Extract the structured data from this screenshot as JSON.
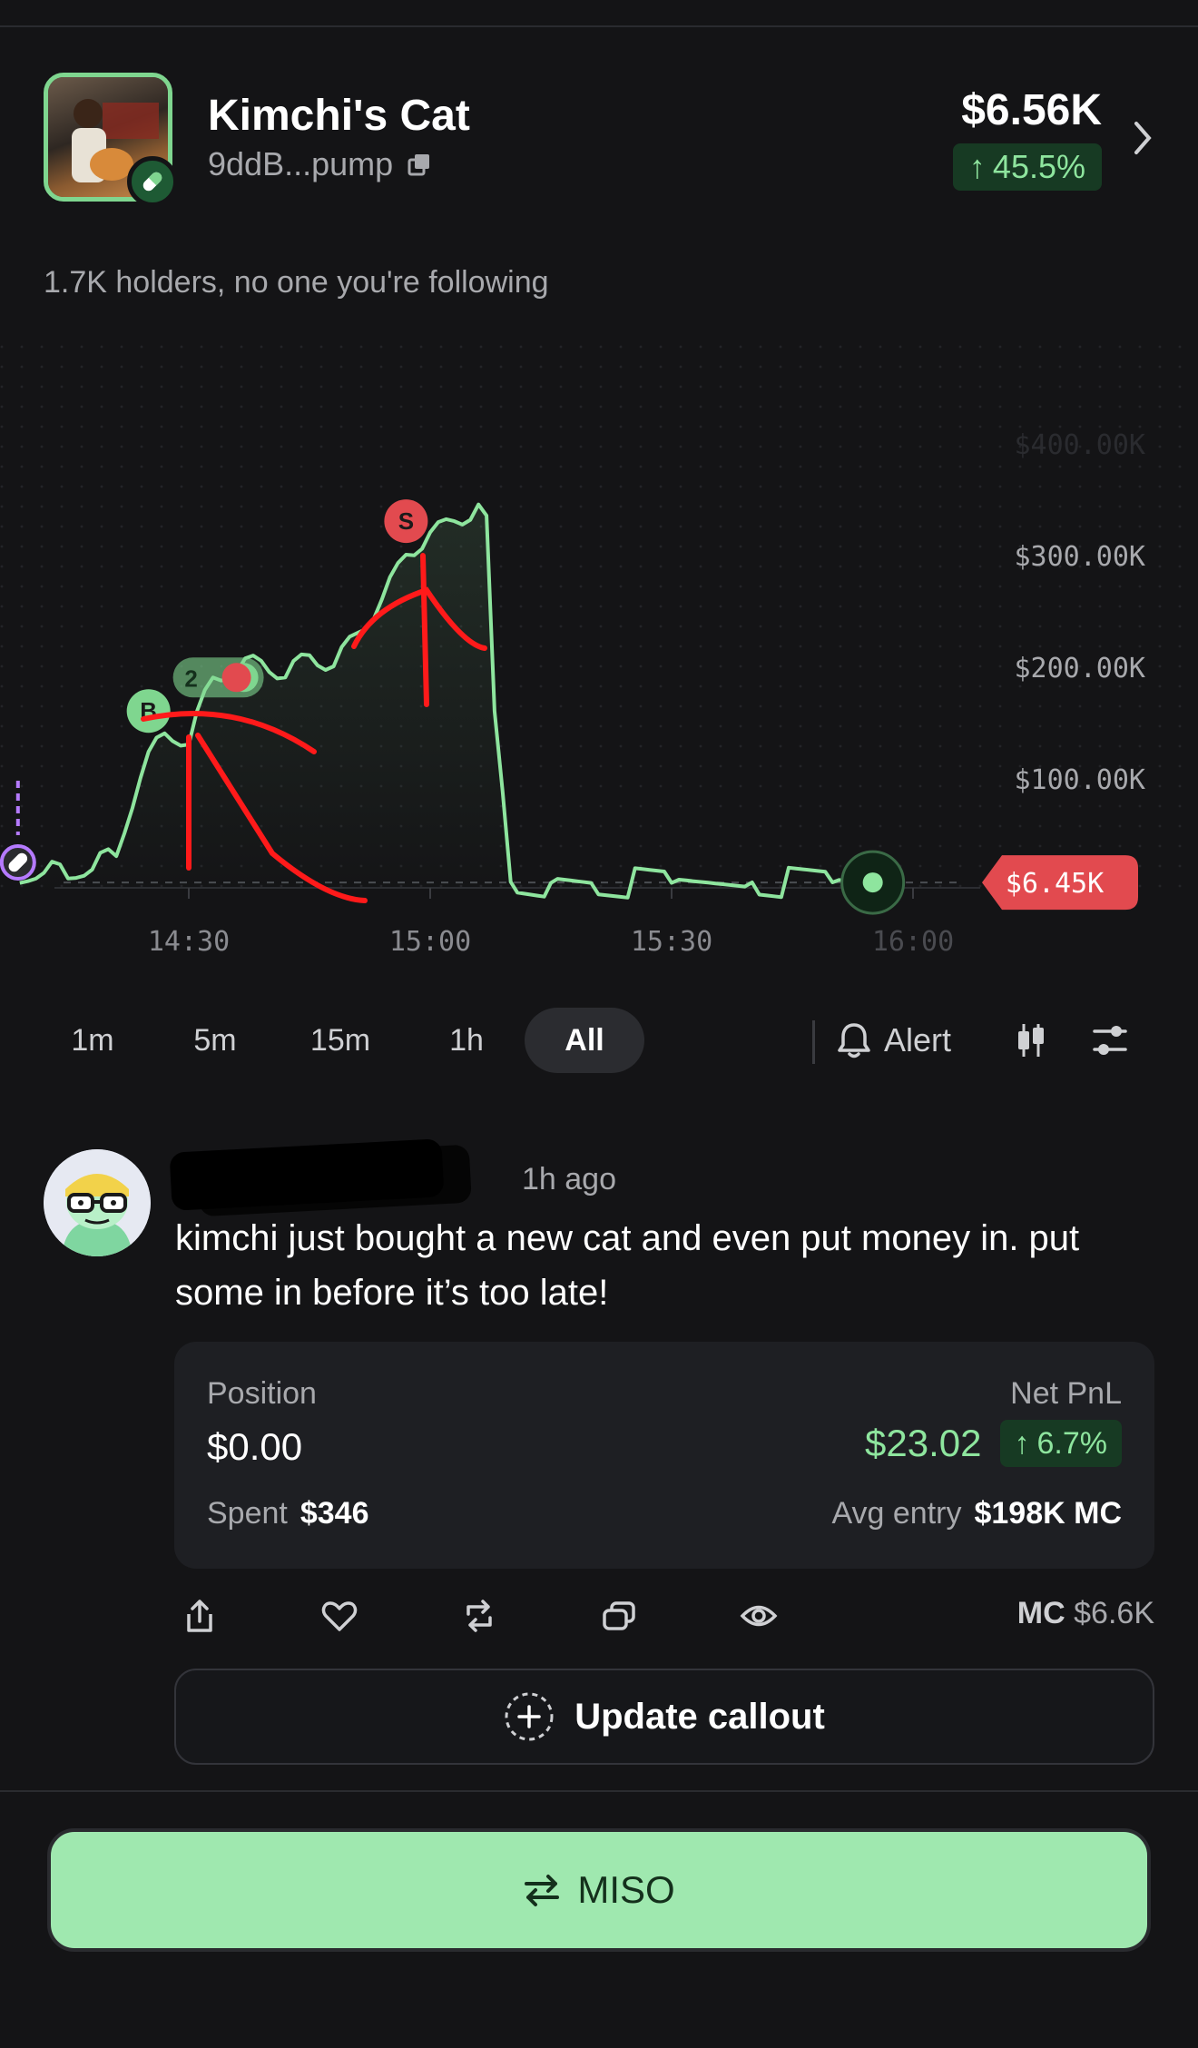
{
  "token": {
    "name": "Kimchi's Cat",
    "address": "9ddB...pump",
    "market_cap": "$6.56K",
    "change": "45.5%",
    "holders_text": "1.7K holders, no one you're following"
  },
  "chart_data": {
    "type": "line",
    "x_tick_labels": [
      "14:30",
      "15:00",
      "15:30",
      "16:00"
    ],
    "y_tick_labels": [
      "$400.00K",
      "$300.00K",
      "$200.00K",
      "$100.00K"
    ],
    "x": [
      "14:09",
      "14:12",
      "14:15",
      "14:18",
      "14:21",
      "14:24",
      "14:27",
      "14:30",
      "14:33",
      "14:36",
      "14:39",
      "14:42",
      "14:45",
      "14:48",
      "14:51",
      "14:54",
      "14:57",
      "15:00",
      "15:03",
      "15:06",
      "15:07",
      "15:08",
      "15:10",
      "15:15",
      "15:20",
      "15:30",
      "15:40",
      "15:50",
      "15:55"
    ],
    "y": [
      6,
      15,
      10,
      18,
      30,
      100,
      140,
      130,
      190,
      195,
      205,
      190,
      210,
      200,
      230,
      260,
      300,
      320,
      330,
      345,
      335,
      160,
      7,
      6,
      6,
      6,
      6.5,
      6.5,
      6.45
    ],
    "ylim": [
      0,
      420
    ],
    "current_value_label": "$6.45K",
    "markers": [
      {
        "label": "B",
        "x": "14:25",
        "y": 160,
        "color": "#7fd68f"
      },
      {
        "label": "2",
        "x": "14:33",
        "y": 190,
        "color": "#7fd68f"
      },
      {
        "label": "S",
        "x": "14:57",
        "y": 330,
        "color": "#e24a4f"
      }
    ],
    "line_color": "#8ee59e",
    "grid": true
  },
  "timeframes": [
    "1m",
    "5m",
    "15m",
    "1h",
    "All"
  ],
  "active_timeframe": "All",
  "alert_label": "Alert",
  "post": {
    "time": "1h ago",
    "text": "kimchi just bought a new cat and even put money in. put some in before it’s too late!"
  },
  "position": {
    "position_label": "Position",
    "position_value": "$0.00",
    "pnl_label": "Net PnL",
    "pnl_value": "$23.02",
    "pnl_change": "6.7%",
    "spent_label": "Spent",
    "spent_value": "$346",
    "avg_entry_label": "Avg entry",
    "avg_entry_value": "$198K MC"
  },
  "actions": {
    "mc_label": "MC",
    "mc_value": "$6.6K",
    "icons": [
      "share-icon",
      "heart-icon",
      "repost-icon",
      "copy-icon",
      "eye-icon"
    ]
  },
  "update_callout_label": "Update callout",
  "trade_button_label": "MISO",
  "colors": {
    "accent_green": "#9fe8af",
    "up_green": "#8ee59e",
    "sell_red": "#e24a4f",
    "background": "#141416"
  }
}
